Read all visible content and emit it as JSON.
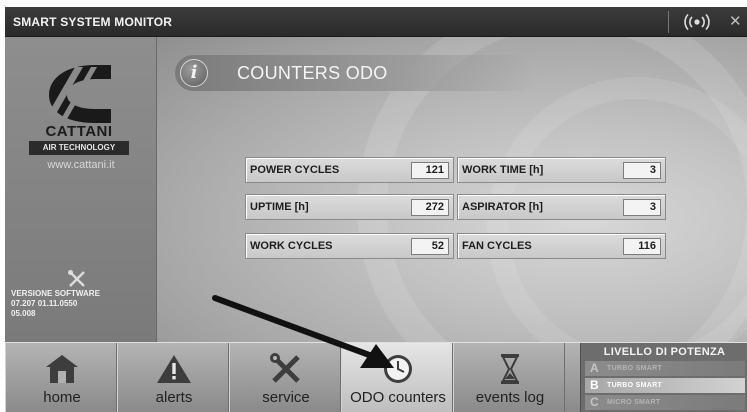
{
  "app": {
    "title": "SMART SYSTEM MONITOR",
    "signal_icon": "wireless-signal-icon",
    "close_glyph": "✕"
  },
  "brand": {
    "name": "CATTANI",
    "subtitle": "AIR TECHNOLOGY",
    "url": "www.cattani.it",
    "software_title": "VERSIONE SOFTWARE",
    "software_line1": "07.207   01.11.0550",
    "software_line2": "05.008"
  },
  "section": {
    "icon": "info-icon",
    "title": "COUNTERS ODO"
  },
  "counters": [
    {
      "label": "POWER CYCLES",
      "value": "121"
    },
    {
      "label": "WORK TIME [h]",
      "value": "3"
    },
    {
      "label": "UPTIME [h]",
      "value": "272"
    },
    {
      "label": "ASPIRATOR [h]",
      "value": "3"
    },
    {
      "label": "WORK CYCLES",
      "value": "52"
    },
    {
      "label": "FAN CYCLES",
      "value": "116"
    }
  ],
  "nav": [
    {
      "label": "home",
      "icon": "home-icon",
      "active": false
    },
    {
      "label": "alerts",
      "icon": "warning-icon",
      "active": false
    },
    {
      "label": "service",
      "icon": "tools-icon",
      "active": false
    },
    {
      "label": "ODO counters",
      "icon": "clock-icon",
      "active": true
    },
    {
      "label": "events log",
      "icon": "hourglass-icon",
      "active": false
    }
  ],
  "power": {
    "title": "LIVELLO DI POTENZA",
    "levels": [
      {
        "letter": "A",
        "name": "TURBO SMART",
        "selected": false
      },
      {
        "letter": "B",
        "name": "TURBO SMART",
        "selected": true
      },
      {
        "letter": "C",
        "name": "MICRO SMART",
        "selected": false
      }
    ]
  }
}
